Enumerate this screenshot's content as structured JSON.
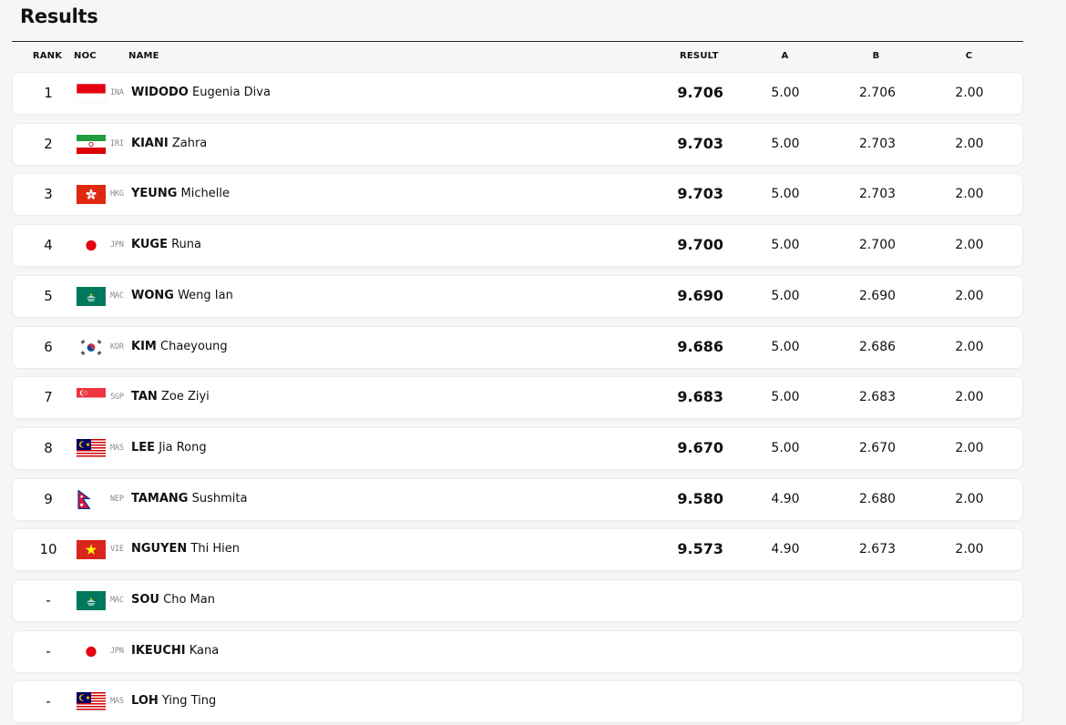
{
  "page": {
    "title": "Results"
  },
  "columns": {
    "rank": "RANK",
    "noc": "NOC",
    "name": "NAME",
    "result": "RESULT",
    "a": "A",
    "b": "B",
    "c": "C"
  },
  "rows": [
    {
      "rank": "1",
      "noc": "INA",
      "surname": "WIDODO",
      "given": "Eugenia Diva",
      "result": "9.706",
      "a": "5.00",
      "b": "2.706",
      "c": "2.00",
      "flag": "indonesia"
    },
    {
      "rank": "2",
      "noc": "IRI",
      "surname": "KIANI",
      "given": "Zahra",
      "result": "9.703",
      "a": "5.00",
      "b": "2.703",
      "c": "2.00",
      "flag": "iran"
    },
    {
      "rank": "3",
      "noc": "HKG",
      "surname": "YEUNG",
      "given": "Michelle",
      "result": "9.703",
      "a": "5.00",
      "b": "2.703",
      "c": "2.00",
      "flag": "hongkong"
    },
    {
      "rank": "4",
      "noc": "JPN",
      "surname": "KUGE",
      "given": "Runa",
      "result": "9.700",
      "a": "5.00",
      "b": "2.700",
      "c": "2.00",
      "flag": "japan"
    },
    {
      "rank": "5",
      "noc": "MAC",
      "surname": "WONG",
      "given": "Weng Ian",
      "result": "9.690",
      "a": "5.00",
      "b": "2.690",
      "c": "2.00",
      "flag": "macao"
    },
    {
      "rank": "6",
      "noc": "KOR",
      "surname": "KIM",
      "given": "Chaeyoung",
      "result": "9.686",
      "a": "5.00",
      "b": "2.686",
      "c": "2.00",
      "flag": "korea"
    },
    {
      "rank": "7",
      "noc": "SGP",
      "surname": "TAN",
      "given": "Zoe Ziyi",
      "result": "9.683",
      "a": "5.00",
      "b": "2.683",
      "c": "2.00",
      "flag": "singapore"
    },
    {
      "rank": "8",
      "noc": "MAS",
      "surname": "LEE",
      "given": "Jia Rong",
      "result": "9.670",
      "a": "5.00",
      "b": "2.670",
      "c": "2.00",
      "flag": "malaysia"
    },
    {
      "rank": "9",
      "noc": "NEP",
      "surname": "TAMANG",
      "given": "Sushmita",
      "result": "9.580",
      "a": "4.90",
      "b": "2.680",
      "c": "2.00",
      "flag": "nepal"
    },
    {
      "rank": "10",
      "noc": "VIE",
      "surname": "NGUYEN",
      "given": "Thi Hien",
      "result": "9.573",
      "a": "4.90",
      "b": "2.673",
      "c": "2.00",
      "flag": "vietnam"
    },
    {
      "rank": "-",
      "noc": "MAC",
      "surname": "SOU",
      "given": "Cho Man",
      "result": "",
      "a": "",
      "b": "",
      "c": "",
      "flag": "macao"
    },
    {
      "rank": "-",
      "noc": "JPN",
      "surname": "IKEUCHI",
      "given": "Kana",
      "result": "",
      "a": "",
      "b": "",
      "c": "",
      "flag": "japan"
    },
    {
      "rank": "-",
      "noc": "MAS",
      "surname": "LOH",
      "given": "Ying Ting",
      "result": "",
      "a": "",
      "b": "",
      "c": "",
      "flag": "malaysia"
    }
  ]
}
